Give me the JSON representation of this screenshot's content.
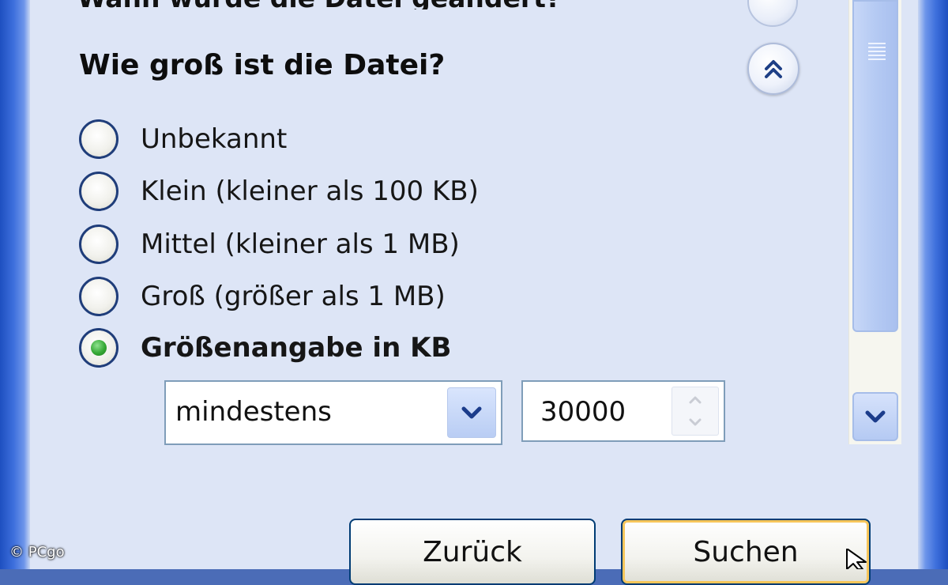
{
  "header": {
    "partial_title": "Wann wurde die Datei geändert?"
  },
  "section": {
    "title": "Wie groß ist die Datei?"
  },
  "size_options": [
    {
      "label": "Unbekannt",
      "selected": false
    },
    {
      "label": "Klein (kleiner als 100 KB)",
      "selected": false
    },
    {
      "label": "Mittel (kleiner als 1 MB)",
      "selected": false
    },
    {
      "label": "Groß (größer als 1 MB)",
      "selected": false
    },
    {
      "label": "Größenangabe in KB",
      "selected": true
    }
  ],
  "size_filter": {
    "comparison": "mindestens",
    "value": "30000"
  },
  "buttons": {
    "back": "Zurück",
    "search": "Suchen"
  },
  "watermark": "© PCgo",
  "colors": {
    "panel": "#dde5f6",
    "frame": "#3d6fdc",
    "radio_selected": "#36a936",
    "button_border": "#003c74"
  }
}
